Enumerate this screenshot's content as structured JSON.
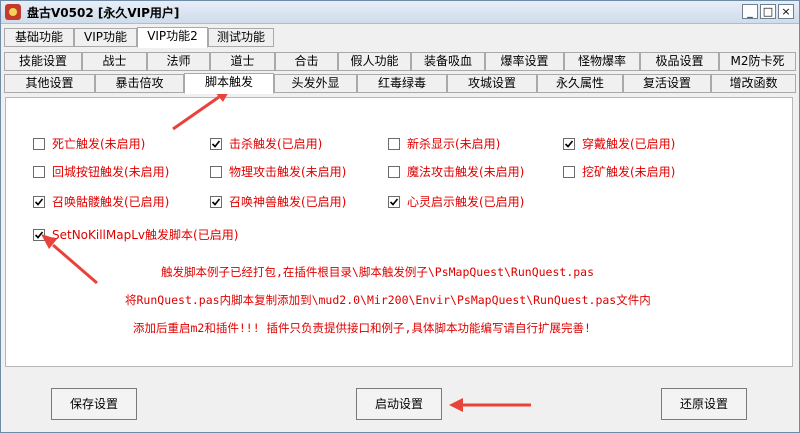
{
  "window": {
    "title": "盘古V0502 [永久VIP用户]",
    "controls": [
      "_",
      "□",
      "×"
    ]
  },
  "tabs": {
    "row1": [
      "基础功能",
      "VIP功能",
      "VIP功能2",
      "测试功能"
    ],
    "row2": [
      "技能设置",
      "战士",
      "法师",
      "道士",
      "合击",
      "假人功能",
      "装备吸血",
      "爆率设置",
      "怪物爆率",
      "极品设置",
      "M2防卡死"
    ],
    "row3": [
      "其他设置",
      "暴击倍攻",
      "脚本触发",
      "头发外显",
      "红毒绿毒",
      "攻城设置",
      "永久属性",
      "复活设置",
      "增改函数"
    ],
    "active_row1": "VIP功能2",
    "active_row3": "脚本触发"
  },
  "checkboxes": [
    {
      "label": "死亡触发(未启用)",
      "checked": false
    },
    {
      "label": "击杀触发(已启用)",
      "checked": true
    },
    {
      "label": "新杀显示(未启用)",
      "checked": false
    },
    {
      "label": "穿戴触发(已启用)",
      "checked": true
    },
    {
      "label": "回城按钮触发(未启用)",
      "checked": false
    },
    {
      "label": "物理攻击触发(未启用)",
      "checked": false
    },
    {
      "label": "魔法攻击触发(未启用)",
      "checked": false
    },
    {
      "label": "挖矿触发(未启用)",
      "checked": false
    },
    {
      "label": "召唤骷髅触发(已启用)",
      "checked": true
    },
    {
      "label": "召唤神兽触发(已启用)",
      "checked": true
    },
    {
      "label": "心灵启示触发(已启用)",
      "checked": true
    },
    {
      "label": "SetNoKillMapLv触发脚本(已启用)",
      "checked": true
    }
  ],
  "notes": [
    "触发脚本例子已经打包,在插件根目录\\脚本触发例子\\PsMapQuest\\RunQuest.pas",
    "将RunQuest.pas内脚本复制添加到\\mud2.0\\Mir200\\Envir\\PsMapQuest\\RunQuest.pas文件内",
    "添加后重启m2和插件!!! 插件只负责提供接口和例子,具体脚本功能编写请自行扩展完善!"
  ],
  "buttons": {
    "save": "保存设置",
    "start": "启动设置",
    "restore": "还原设置"
  },
  "colors": {
    "accent_red": "#e00000",
    "arrow_red": "#e8423a"
  }
}
